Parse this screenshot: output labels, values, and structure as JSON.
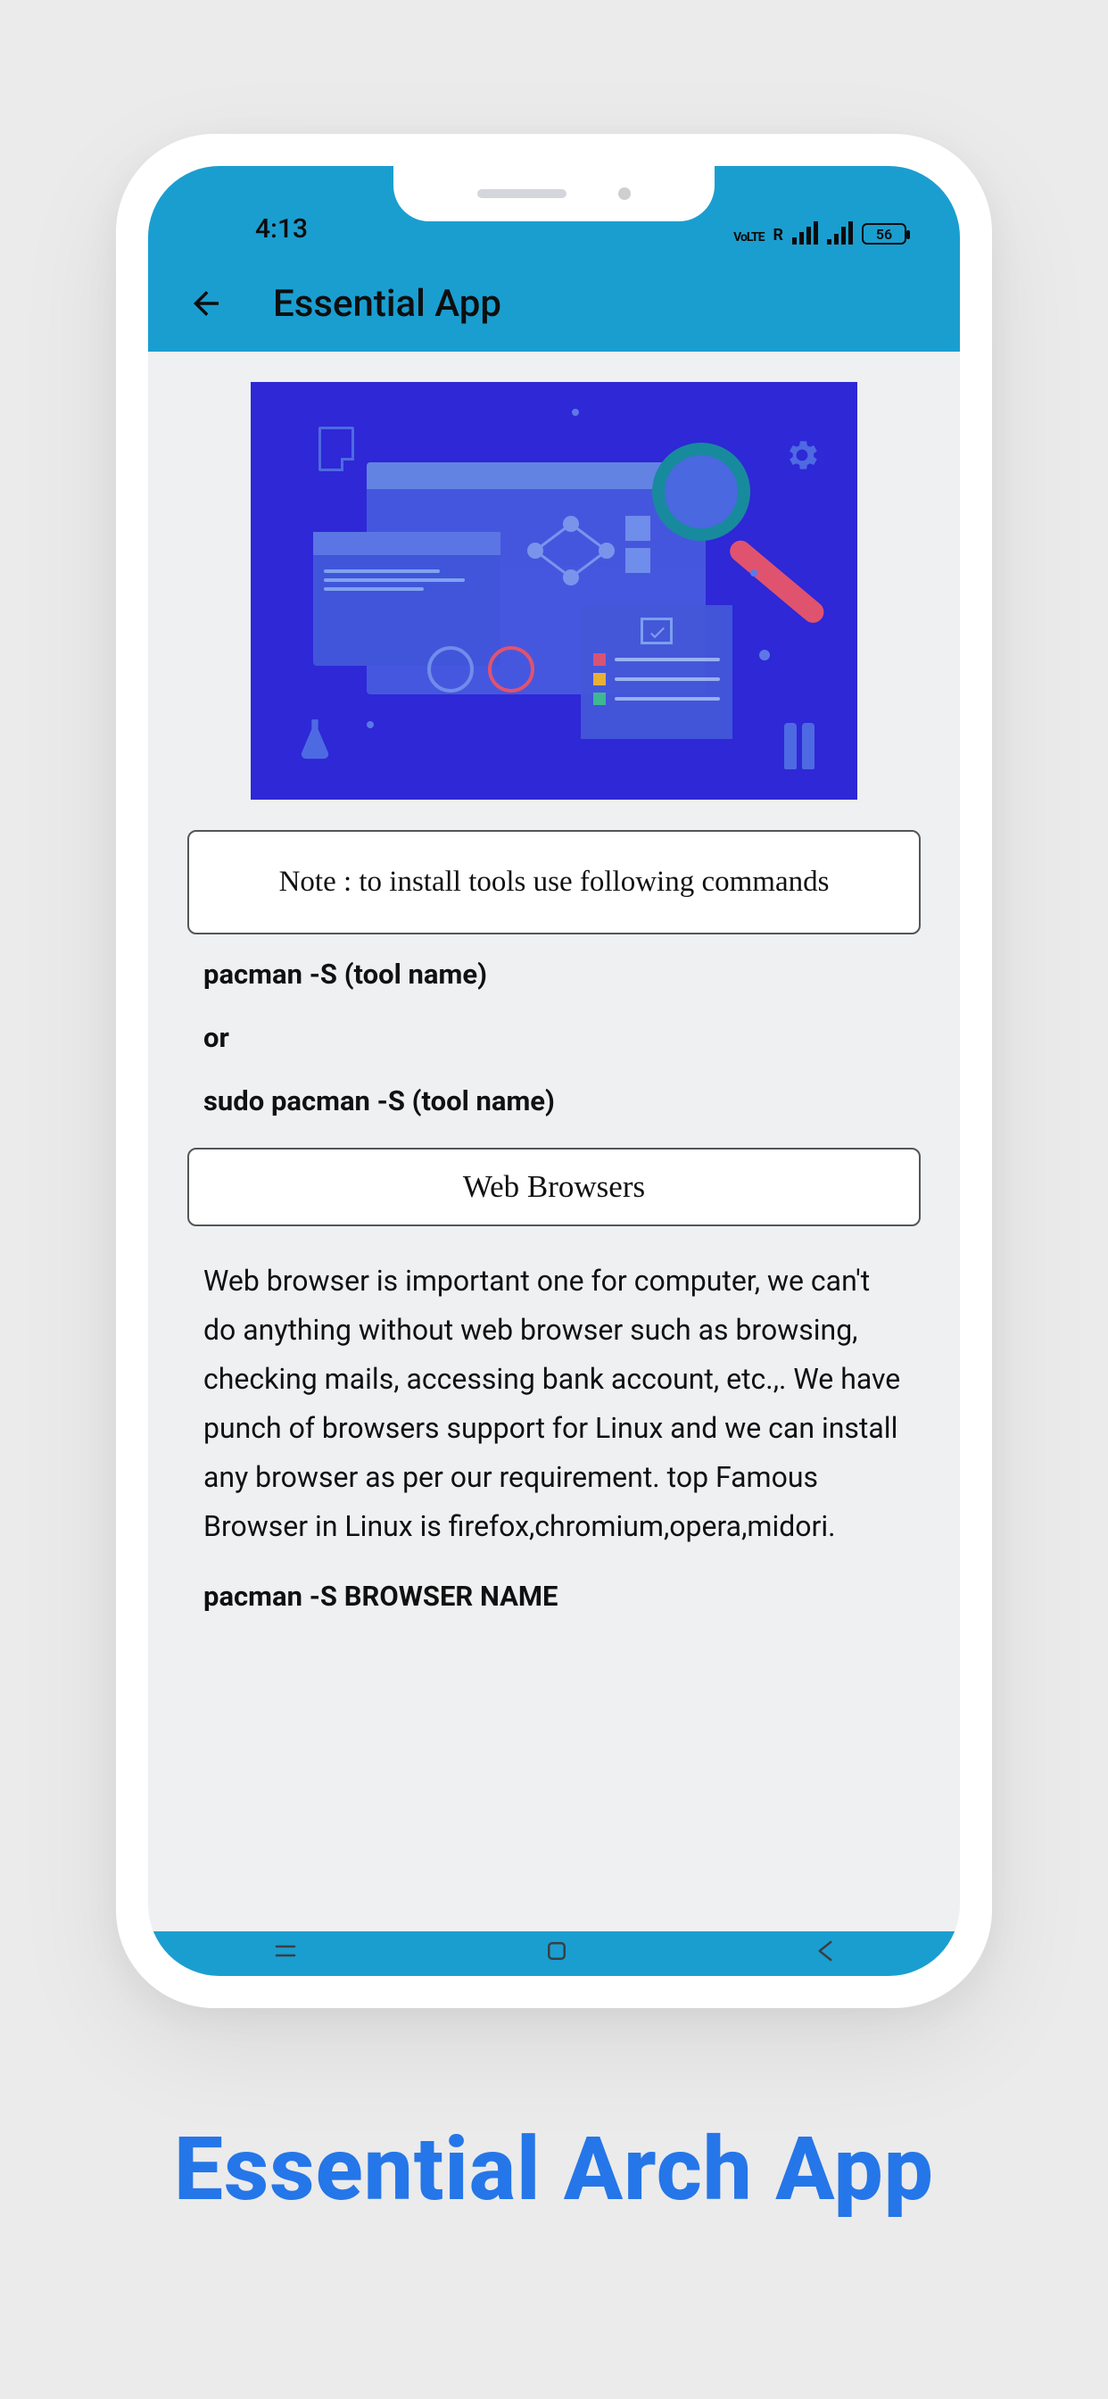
{
  "status": {
    "time": "4:13",
    "battery_text": "56"
  },
  "appbar": {
    "title": "Essential App"
  },
  "content": {
    "note": "Note : to install tools use following commands",
    "cmd1": "pacman -S (tool name)",
    "or": "or",
    "cmd2": "sudo pacman -S (tool name)",
    "section_title": "Web Browsers",
    "section_body": "Web browser is important one for computer, we can't do anything without web browser such as browsing, checking mails, accessing bank account, etc.,. We have punch of browsers support for Linux and we can install any browser as per our requirement. top Famous Browser in Linux is firefox,chromium,opera,midori.",
    "section_cmd": "pacman -S BROWSER NAME"
  },
  "caption": "Essential Arch App"
}
